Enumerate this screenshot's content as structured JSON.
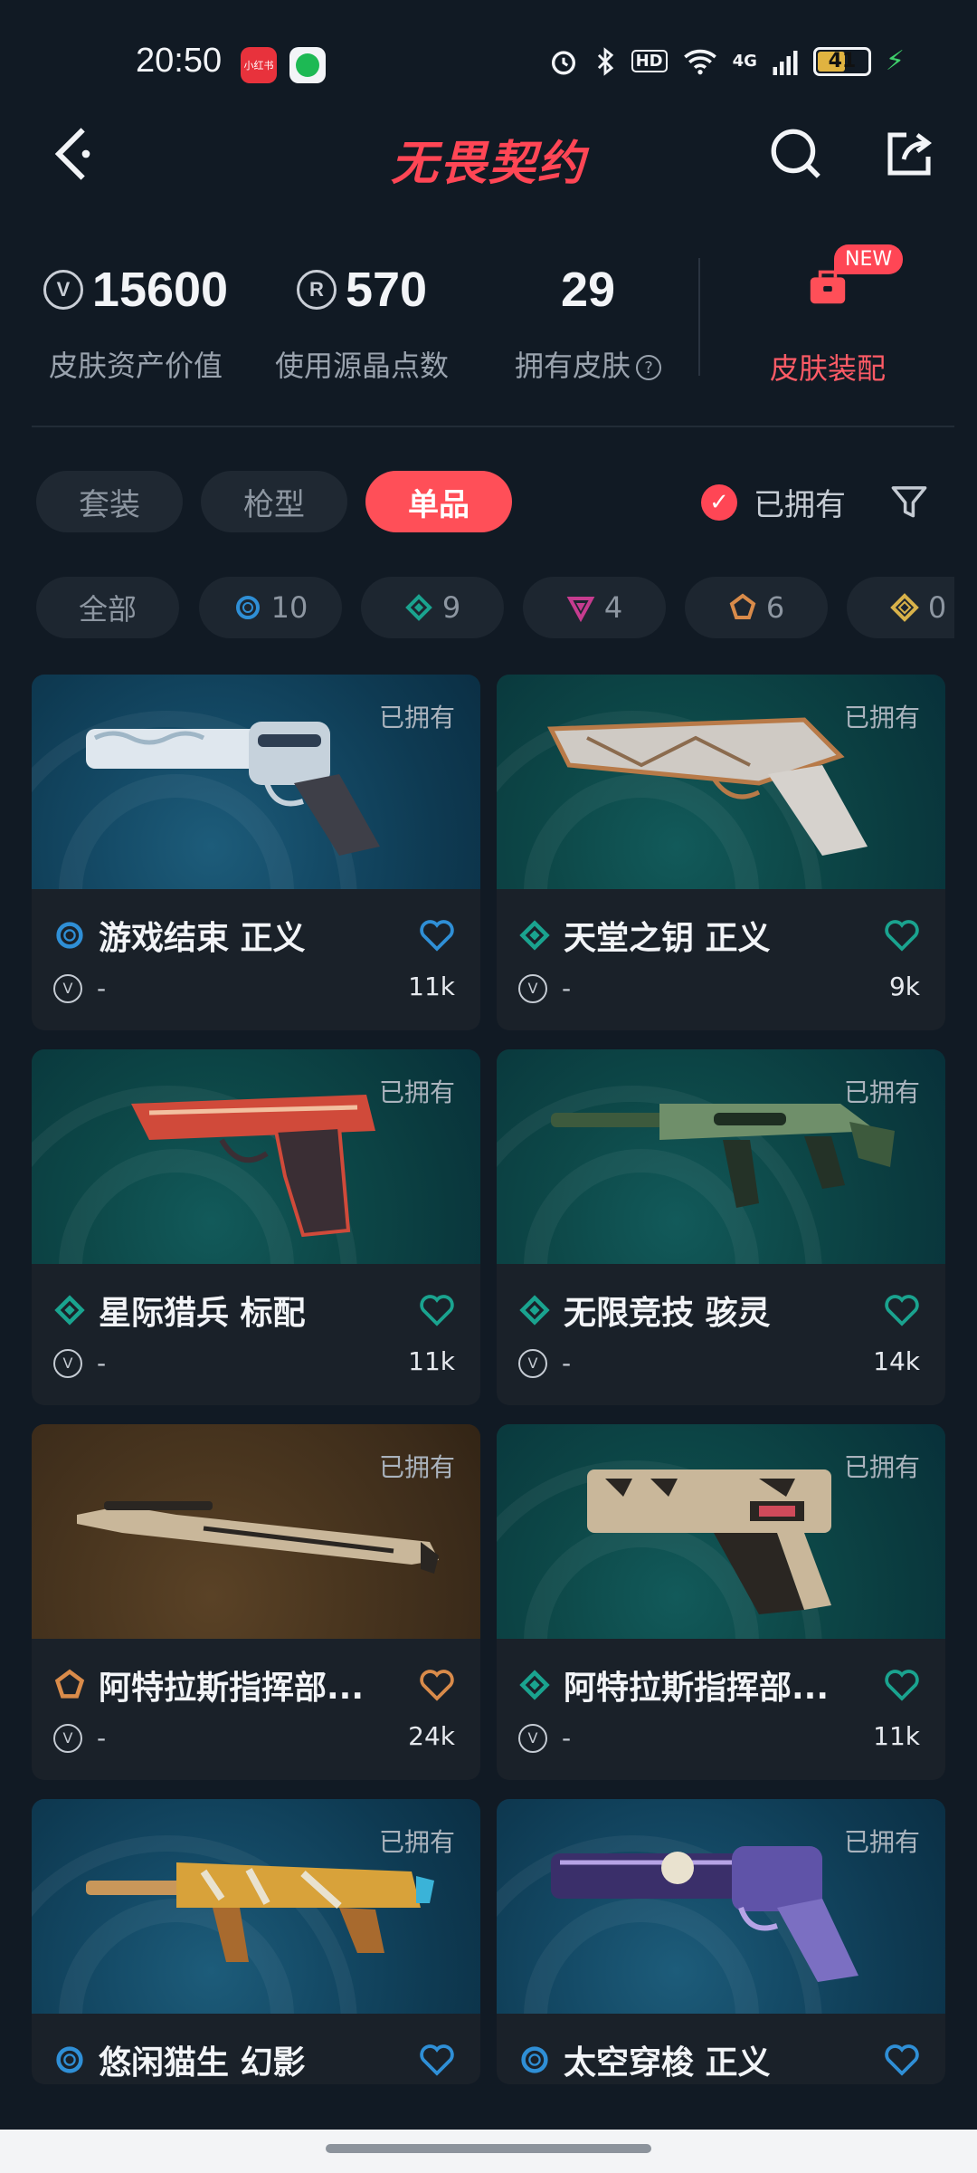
{
  "status_bar": {
    "time": "20:50",
    "app1_label": "小红书",
    "network": "4G",
    "hd": "HD",
    "battery": "41",
    "icons": [
      "alarm-icon",
      "bluetooth-icon",
      "wifi-icon",
      "signal-icon",
      "battery-icon",
      "charging-icon"
    ]
  },
  "header": {
    "title": "无畏契约",
    "back_icon": "back-chevron-icon",
    "search_icon": "search-icon",
    "share_icon": "share-icon"
  },
  "stats": {
    "asset_value": "15600",
    "asset_label": "皮肤资产价值",
    "points": "570",
    "points_label": "使用源晶点数",
    "skins_owned": "29",
    "skins_label": "拥有皮肤",
    "outfit_badge": "NEW",
    "outfit_label": "皮肤装配"
  },
  "tabs": [
    "套装",
    "枪型",
    "单品"
  ],
  "active_tab": "单品",
  "owned_filter": {
    "label": "已拥有",
    "checked": true
  },
  "tiers": [
    {
      "label": "全部"
    },
    {
      "icon": "select-tier-icon",
      "count": "10",
      "color": "#2f8fd6"
    },
    {
      "icon": "deluxe-tier-icon",
      "count": "9",
      "color": "#1aa38f"
    },
    {
      "icon": "premium-tier-icon",
      "count": "4",
      "color": "#c63c8f"
    },
    {
      "icon": "exclusive-tier-icon",
      "count": "6",
      "color": "#d98b4a"
    },
    {
      "icon": "ultra-tier-icon",
      "count": "0",
      "color": "#d8b24a"
    }
  ],
  "cards": [
    {
      "name": "游戏结束 正义",
      "owned": "已拥有",
      "price": "-",
      "likes": "11k",
      "tier_color": "#2f8fd6",
      "tier_icon": "select-tier-icon",
      "bg": "blue"
    },
    {
      "name": "天堂之钥 正义",
      "owned": "已拥有",
      "price": "-",
      "likes": "9k",
      "tier_color": "#1aa38f",
      "tier_icon": "deluxe-tier-icon",
      "bg": "teal"
    },
    {
      "name": "星际猎兵 标配",
      "owned": "已拥有",
      "price": "-",
      "likes": "11k",
      "tier_color": "#1aa38f",
      "tier_icon": "deluxe-tier-icon",
      "bg": "teal"
    },
    {
      "name": "无限竞技 骇灵",
      "owned": "已拥有",
      "price": "-",
      "likes": "14k",
      "tier_color": "#1aa38f",
      "tier_icon": "deluxe-tier-icon",
      "bg": "teal"
    },
    {
      "name": "阿特拉斯指挥部...",
      "owned": "已拥有",
      "price": "-",
      "likes": "24k",
      "tier_color": "#d98b4a",
      "tier_icon": "exclusive-tier-icon",
      "bg": "brown"
    },
    {
      "name": "阿特拉斯指挥部...",
      "owned": "已拥有",
      "price": "-",
      "likes": "11k",
      "tier_color": "#1aa38f",
      "tier_icon": "deluxe-tier-icon",
      "bg": "teal"
    },
    {
      "name": "悠闲猫生 幻影",
      "owned": "已拥有",
      "price": "-",
      "likes": "",
      "tier_color": "#2f8fd6",
      "tier_icon": "select-tier-icon",
      "bg": "blue"
    },
    {
      "name": "太空穿梭 正义",
      "owned": "已拥有",
      "price": "-",
      "likes": "",
      "tier_color": "#2f8fd6",
      "tier_icon": "select-tier-icon",
      "bg": "blue"
    }
  ],
  "colors": {
    "accent": "#ff4655",
    "background": "#111a24",
    "card": "#1a2129"
  }
}
